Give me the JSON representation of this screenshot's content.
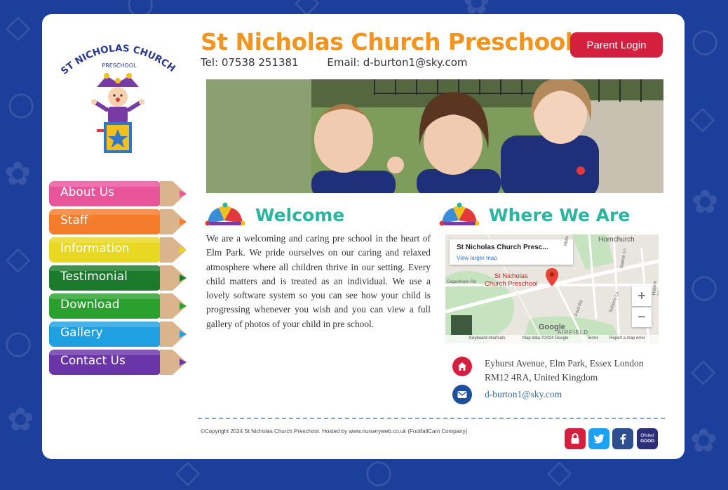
{
  "header": {
    "logo_line1": "ST NICHOLAS CHURCH",
    "logo_line2": "PRESCHOOL",
    "title": "St Nicholas Church Preschool",
    "tel": "Tel: 07538 251381",
    "email": "Email: d-burton1@sky.com",
    "login_label": "Parent Login"
  },
  "nav": {
    "items": [
      {
        "label": "About Us",
        "color": "#e8559b"
      },
      {
        "label": "Staff",
        "color": "#f47c2a"
      },
      {
        "label": "Information",
        "color": "#e9d822"
      },
      {
        "label": "Testimonial",
        "color": "#1c7a2c"
      },
      {
        "label": "Download",
        "color": "#2aa02e"
      },
      {
        "label": "Gallery",
        "color": "#1fa0e0"
      },
      {
        "label": "Contact Us",
        "color": "#6a35a8"
      }
    ]
  },
  "welcome": {
    "heading": "Welcome",
    "body": "We are a welcoming and caring pre school in the heart of Elm Park. We pride ourselves on our caring and relaxed atmosphere where all children thrive in our setting. Every child matters and is treated as an individual. We use a lovely software system so you can see how your child is progressing whenever you wish and you can view a full gallery of photos of your child in pre school."
  },
  "where": {
    "heading": "Where We Are",
    "map": {
      "popup_title": "St Nicholas Church Presc...",
      "popup_link": "View larger map",
      "marker_label_1": "St Nicholas",
      "marker_label_2": "Church Preschool",
      "place_hornchurch": "Hornchurch",
      "place_airfield": "AIRFIELD",
      "road_dagenham": "Dagenham Rd",
      "road_abbs": "Abbs Cross Ln",
      "road_station": "Station Ln",
      "road_ford": "Ford Rd",
      "road_suttons": "Suttons Ln",
      "road_hacton": "Hacton Ln",
      "google": "Google",
      "zoom_in": "+",
      "zoom_out": "−",
      "footer_shortcuts": "Keyboard shortcuts",
      "footer_data": "Map data ©2024 Google",
      "footer_terms": "Terms",
      "footer_report": "Report a map error"
    },
    "address_line1": "Eyhurst Avenue, Elm Park, Essex London",
    "address_line2": "RM12 4RA, United Kingdom",
    "email_link": "d-burton1@sky.com"
  },
  "footer": {
    "copyright": "©Copyright 2024 St Nicholas Church Preschool. Hosted by www.nurseryweb.co.uk (FootfallCam Company)",
    "icons": [
      "lock-icon",
      "twitter-icon",
      "facebook-icon",
      "ofsted-good-badge"
    ],
    "ofsted_line1": "Ofsted",
    "ofsted_line2": "GOOD"
  },
  "colors": {
    "background": "#1d3f9c",
    "title_orange": "#f1951f",
    "heading_teal": "#2bb5a0",
    "login_red": "#d51f3e"
  }
}
